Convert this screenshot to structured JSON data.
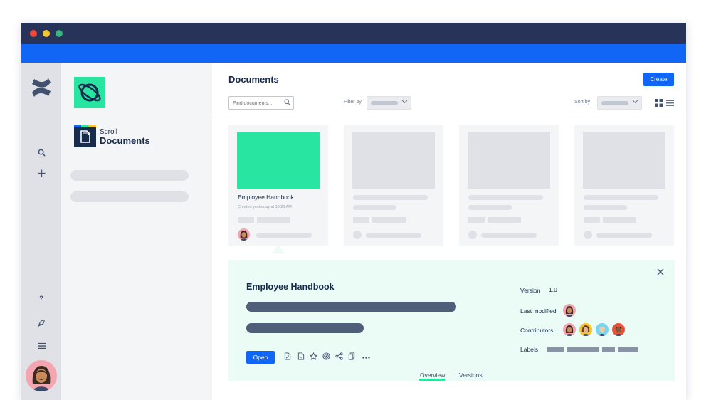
{
  "window": {
    "controls": [
      "close-dot",
      "minimize-dot",
      "zoom-dot"
    ]
  },
  "nav": {
    "help_label": "?",
    "icons": [
      "confluence-logo-icon",
      "search-icon",
      "plus-icon",
      "help-icon",
      "rocket-icon",
      "menu-icon"
    ]
  },
  "space": {
    "app_name_small": "Scroll",
    "app_name_big": "Documents"
  },
  "main": {
    "title": "Documents",
    "create_label": "Create",
    "search_placeholder": "Find documents...",
    "filter_label": "Filter by",
    "sort_label": "Sort by",
    "view_modes": [
      "grid-view-icon",
      "list-view-icon"
    ]
  },
  "cards": [
    {
      "title": "Employee Handbook",
      "subtitle": "Created yesterday at 10:26 AM"
    }
  ],
  "detail": {
    "title": "Employee Handbook",
    "open_label": "Open",
    "version_label": "Version",
    "version_value": "1.0",
    "last_modified_label": "Last modified",
    "contributors_label": "Contributors",
    "labels_label": "Labels",
    "tabs": [
      {
        "label": "Overview",
        "active": true
      },
      {
        "label": "Versions",
        "active": false
      }
    ],
    "toolbar_icons": [
      "pdf-export-icon",
      "word-export-icon",
      "star-icon",
      "watch-icon",
      "share-icon",
      "copy-icon",
      "more-icon"
    ]
  },
  "colors": {
    "titlebar": "#273358",
    "brand_blue": "#1166f5",
    "accent_green": "#28e5a1",
    "detail_bg": "#eafcf5"
  }
}
